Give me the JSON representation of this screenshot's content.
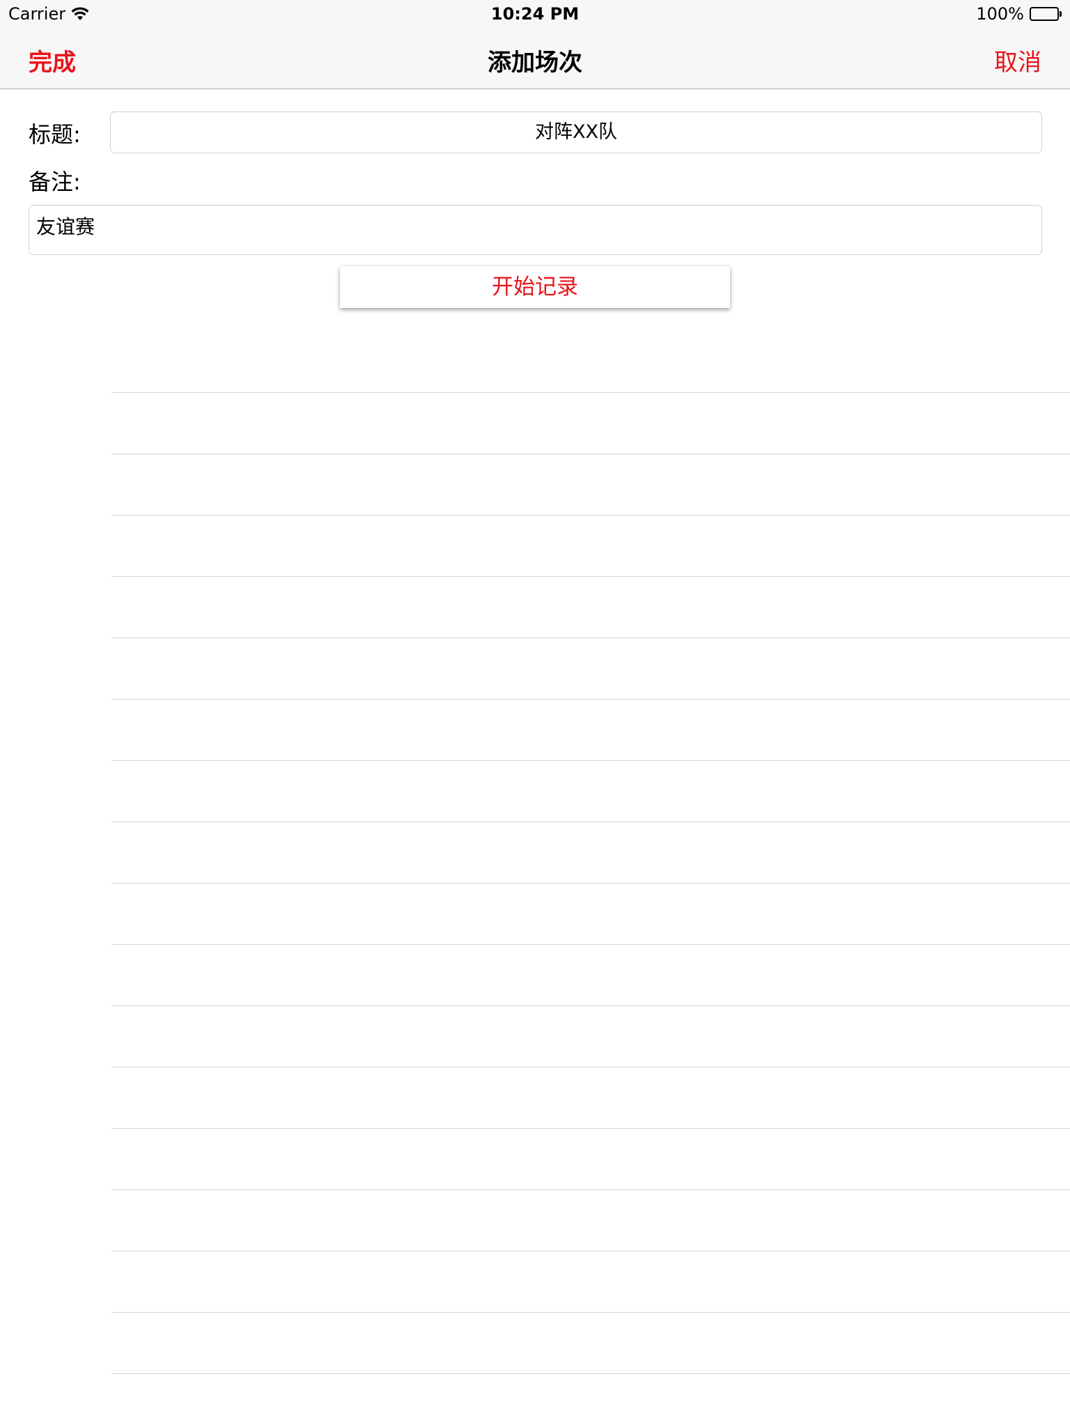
{
  "status_bar": {
    "carrier": "Carrier",
    "time": "10:24 PM",
    "battery": "100%",
    "icons": [
      "wifi-icon",
      "battery-icon"
    ],
    "battery_level": 1.0
  },
  "nav": {
    "left_button": "完成",
    "title": "添加场次",
    "right_button": "取消",
    "accent_color": "#e8141b"
  },
  "form": {
    "title_label": "标题:",
    "title_value": "对阵XX队",
    "notes_label": "备注:",
    "notes_value": "友谊赛",
    "start_button": "开始记录"
  },
  "list": {
    "row_count": 17
  }
}
